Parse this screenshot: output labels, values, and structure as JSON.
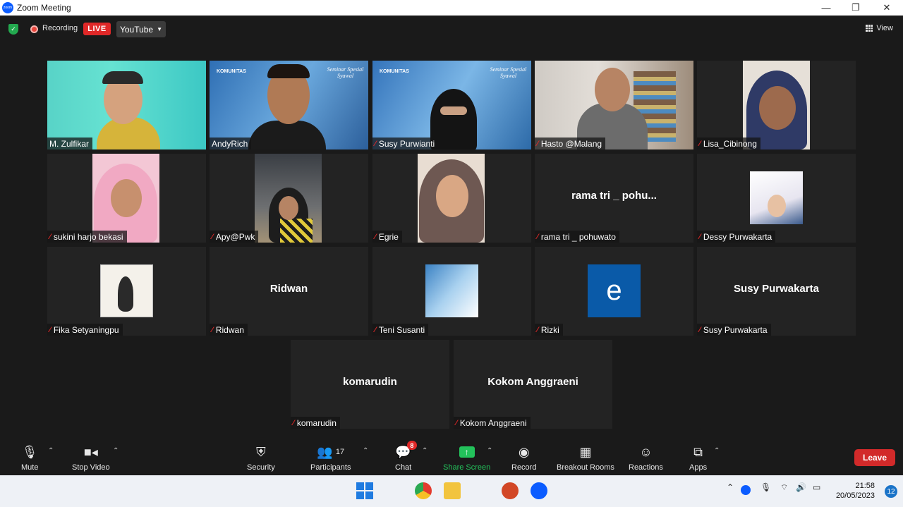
{
  "window": {
    "title": "Zoom Meeting",
    "minimize": "—",
    "restore": "❐",
    "close": "✕"
  },
  "topbar": {
    "recording_label": "Recording",
    "live_label": "LIVE",
    "stream_target": "YouTube",
    "view_label": "View"
  },
  "slide": {
    "brand": "KOMUNITAS",
    "banner": "Seminar Spesial Syawal"
  },
  "tiles": [
    {
      "name": "M. Zulfikar"
    },
    {
      "name": "AndyRich"
    },
    {
      "name": "Susy Purwianti"
    },
    {
      "name": "Hasto @Malang"
    },
    {
      "name": "Lisa_Cibinong"
    },
    {
      "name": "sukini harjo bekasi"
    },
    {
      "name": "Apy@Pwk"
    },
    {
      "name": "Egrie"
    },
    {
      "name": "rama tri _ pohuwato",
      "display": "rama tri _ pohu..."
    },
    {
      "name": "Dessy Purwakarta"
    },
    {
      "name": "Fika Setyaningpu"
    },
    {
      "name": "Ridwan",
      "display": "Ridwan"
    },
    {
      "name": "Teni Susanti"
    },
    {
      "name": "Rizki",
      "avatar_letter": "e"
    },
    {
      "name": "Susy Purwakarta",
      "display": "Susy Purwakarta"
    },
    {
      "name": "komarudin",
      "display": "komarudin"
    },
    {
      "name": "Kokom Anggraeni",
      "display": "Kokom Anggraeni"
    }
  ],
  "toolbar": {
    "mute": "Mute",
    "stop_video": "Stop Video",
    "security": "Security",
    "participants": "Participants",
    "participants_count": "17",
    "chat": "Chat",
    "chat_badge": "8",
    "share_screen": "Share Screen",
    "record": "Record",
    "breakout": "Breakout Rooms",
    "reactions": "Reactions",
    "apps": "Apps",
    "leave": "Leave"
  },
  "taskbar": {
    "time": "21:58",
    "date": "20/05/2023",
    "notifications": "12"
  },
  "colors": {
    "active_speaker": "#d7e36a",
    "live": "#e02828",
    "share": "#23c25b",
    "leave": "#d22a2a"
  }
}
